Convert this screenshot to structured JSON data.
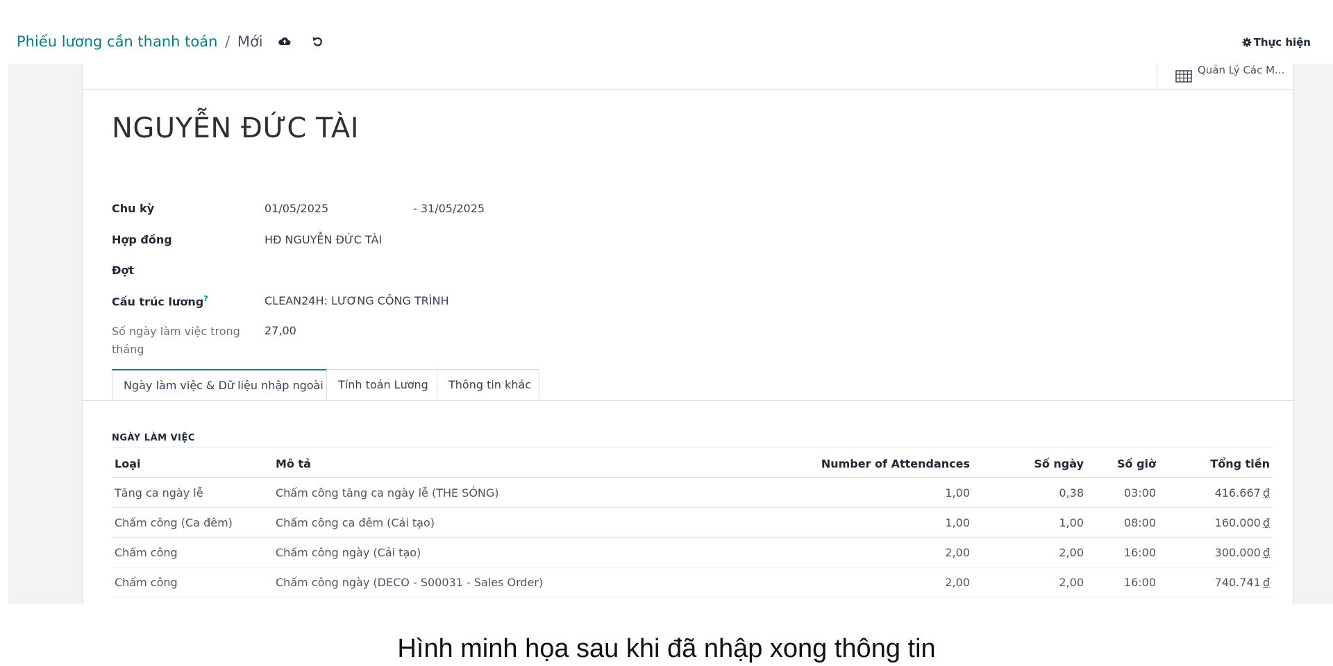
{
  "breadcrumb": {
    "parent": "Phiếu lương cần thanh toán",
    "separator": "/",
    "current": "Mới"
  },
  "icons": {
    "save": "cloud-upload-icon",
    "discard": "undo-icon",
    "action": "gear-icon",
    "smart": "grid-icon"
  },
  "action_menu": {
    "label": "Thực hiện"
  },
  "smart_button": {
    "label": "Quản Lý Các M..."
  },
  "employee_name": "NGUYỄN ĐỨC TÀI",
  "fields": {
    "period": {
      "label": "Chu kỳ",
      "from": "01/05/2025",
      "to": "- 31/05/2025"
    },
    "contract": {
      "label": "Hợp đồng",
      "value": "HĐ NGUYỄN ĐỨC TÀI"
    },
    "batch": {
      "label": "Đợt",
      "value": ""
    },
    "structure": {
      "label": "Cấu trúc lương",
      "help": "?",
      "value": "CLEAN24H: LƯƠNG CÔNG TRÌNH"
    },
    "working_days": {
      "label": "Số ngày làm việc trong tháng",
      "value": "27,00"
    }
  },
  "tabs": [
    {
      "label": "Ngày làm việc & Dữ liệu nhập ngoài",
      "active": true
    },
    {
      "label": "Tính toán Lương",
      "active": false
    },
    {
      "label": "Thông tin khác",
      "active": false
    }
  ],
  "worked_days": {
    "section_title": "NGÀY LÀM VIỆC",
    "columns": [
      "Loại",
      "Mô tả",
      "Number of Attendances",
      "Số ngày",
      "Số giờ",
      "Tổng tiền"
    ],
    "currency": "₫",
    "rows": [
      {
        "type": "Tăng ca ngày lễ",
        "desc": "Chấm công tăng ca ngày lễ (THE SÓNG)",
        "attendances": "1,00",
        "days": "0,38",
        "hours": "03:00",
        "amount": "416.667"
      },
      {
        "type": "Chấm công (Ca đêm)",
        "desc": "Chấm công ca đêm (Cải tạo)",
        "attendances": "1,00",
        "days": "1,00",
        "hours": "08:00",
        "amount": "160.000"
      },
      {
        "type": "Chấm công",
        "desc": "Chấm công ngày (Cải tạo)",
        "attendances": "2,00",
        "days": "2,00",
        "hours": "16:00",
        "amount": "300.000"
      },
      {
        "type": "Chấm công",
        "desc": "Chấm công ngày (DECO - S00031 - Sales Order)",
        "attendances": "2,00",
        "days": "2,00",
        "hours": "16:00",
        "amount": "740.741"
      }
    ]
  },
  "caption": "Hình minh họa sau khi đã nhập xong thông tin"
}
